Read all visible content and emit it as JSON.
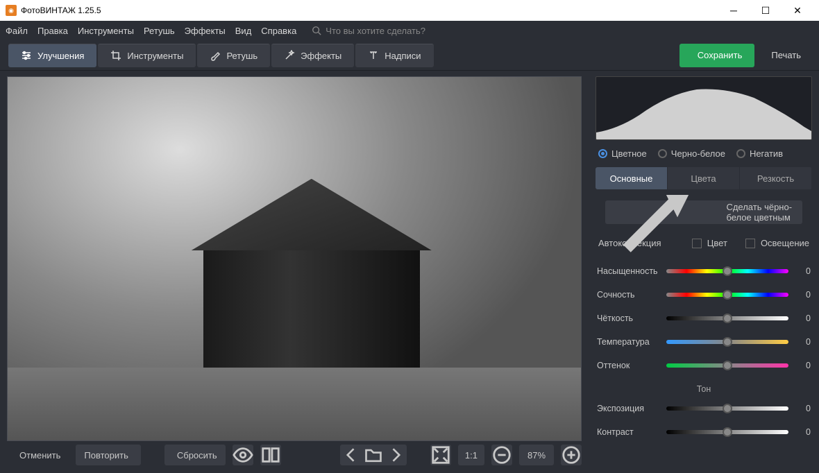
{
  "window": {
    "title": "ФотоВИНТАЖ 1.25.5"
  },
  "menu": {
    "file": "Файл",
    "edit": "Правка",
    "tools": "Инструменты",
    "retouch": "Ретушь",
    "effects": "Эффекты",
    "view": "Вид",
    "help": "Справка",
    "search_placeholder": "Что вы хотите сделать?"
  },
  "toolbar": {
    "enhance": "Улучшения",
    "tools": "Инструменты",
    "retouch": "Ретушь",
    "effects": "Эффекты",
    "captions": "Надписи",
    "save": "Сохранить",
    "print": "Печать"
  },
  "bottombar": {
    "undo": "Отменить",
    "redo": "Повторить",
    "reset": "Сбросить",
    "ratio": "1:1",
    "zoom": "87%"
  },
  "right": {
    "color_modes": {
      "color": "Цветное",
      "bw": "Черно-белое",
      "negative": "Негатив"
    },
    "tabs": {
      "basic": "Основные",
      "colors": "Цвета",
      "sharpness": "Резкость"
    },
    "wand": "Сделать чёрно-белое цветным",
    "auto": {
      "label": "Автокоррекция",
      "color": "Цвет",
      "light": "Освещение"
    },
    "sliders": {
      "saturation": {
        "label": "Насыщенность",
        "value": "0"
      },
      "vibrance": {
        "label": "Сочность",
        "value": "0"
      },
      "clarity": {
        "label": "Чёткость",
        "value": "0"
      },
      "temperature": {
        "label": "Температура",
        "value": "0"
      },
      "tint": {
        "label": "Оттенок",
        "value": "0"
      }
    },
    "tone_section": "Тон",
    "tone": {
      "exposure": {
        "label": "Экспозиция",
        "value": "0"
      },
      "contrast": {
        "label": "Контраст",
        "value": "0"
      }
    }
  }
}
